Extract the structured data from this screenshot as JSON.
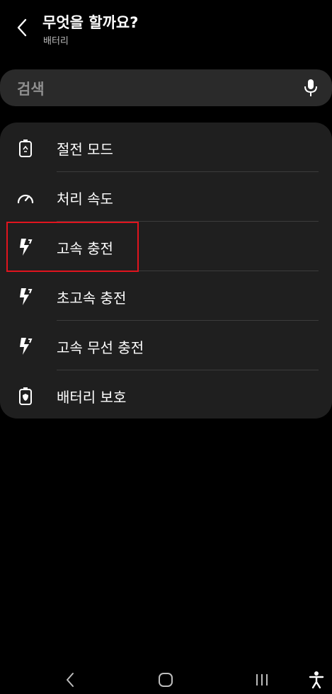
{
  "header": {
    "title": "무엇을 할까요?",
    "subtitle": "배터리"
  },
  "search": {
    "placeholder": "검색"
  },
  "menu": {
    "items": [
      {
        "label": "절전 모드",
        "icon": "battery-recycle-icon"
      },
      {
        "label": "처리 속도",
        "icon": "speedometer-icon"
      },
      {
        "label": "고속 충전",
        "icon": "lightning-icon"
      },
      {
        "label": "초고속 충전",
        "icon": "lightning-icon"
      },
      {
        "label": "고속 무선 충전",
        "icon": "lightning-icon"
      },
      {
        "label": "배터리 보호",
        "icon": "battery-shield-icon"
      }
    ]
  },
  "navbar": {
    "icons": [
      "back-icon",
      "home-icon",
      "recents-icon",
      "accessibility-icon"
    ]
  },
  "colors": {
    "background": "#000000",
    "card": "#1f1f1f",
    "search": "#2a2a2a",
    "highlight": "#e1141e"
  }
}
